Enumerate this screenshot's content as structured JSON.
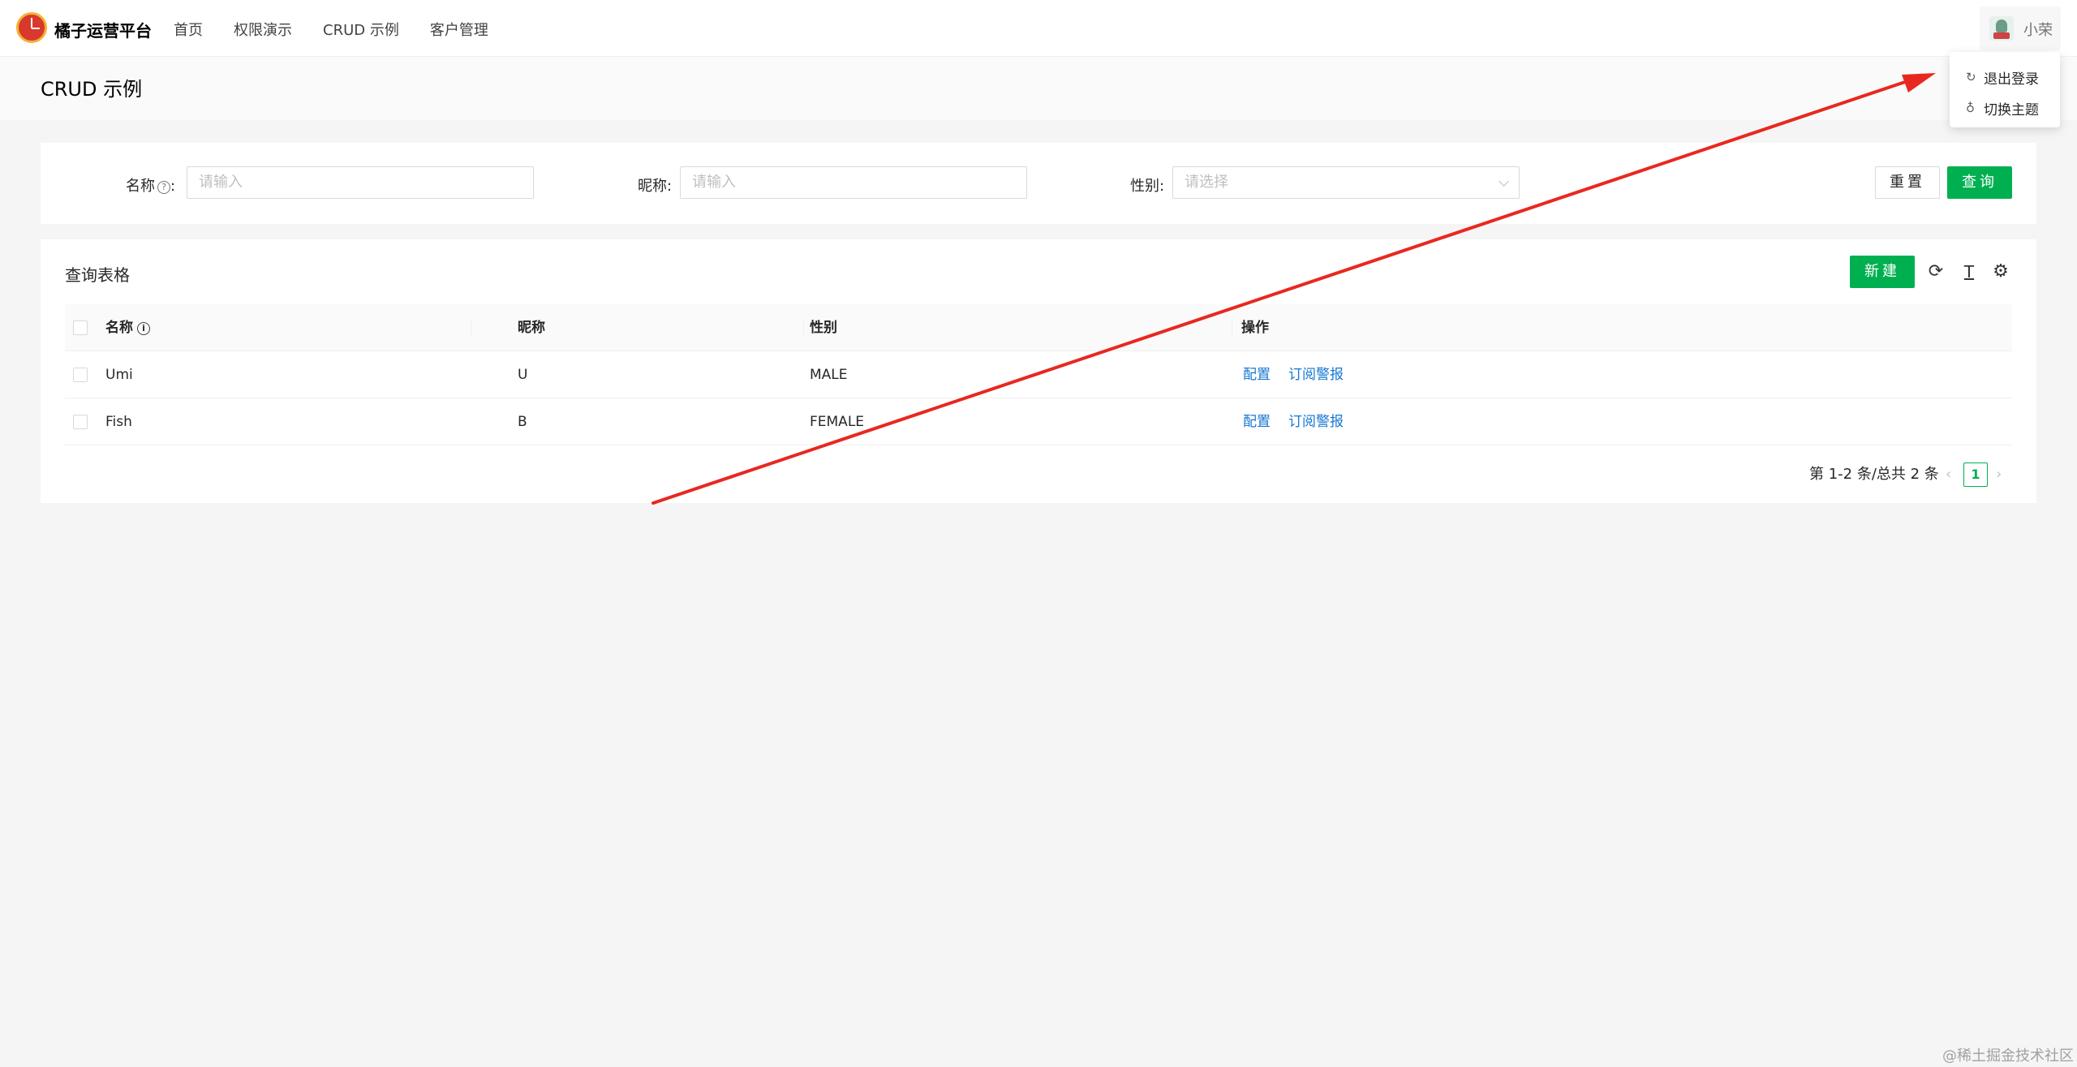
{
  "header": {
    "app_title": "橘子运营平台",
    "nav": [
      "首页",
      "权限演示",
      "CRUD 示例",
      "客户管理"
    ],
    "user_name": "小荣"
  },
  "user_menu": {
    "items": [
      {
        "icon": "logout-icon",
        "label": "退出登录"
      },
      {
        "icon": "bulb-icon",
        "label": "切换主题"
      }
    ]
  },
  "page": {
    "title": "CRUD 示例"
  },
  "search": {
    "name_label": "名称",
    "name_help_icon": "question-circle-icon",
    "name_placeholder": "请输入",
    "nickname_label": "昵称:",
    "nickname_placeholder": "请输入",
    "gender_label": "性别:",
    "gender_placeholder": "请选择",
    "reset_label": "重置",
    "query_label": "查询"
  },
  "table": {
    "title": "查询表格",
    "new_label": "新建",
    "columns": [
      "名称",
      "昵称",
      "性别",
      "操作"
    ],
    "rows": [
      {
        "name": "Umi",
        "nickname": "U",
        "gender": "MALE",
        "action_config": "配置",
        "action_subscribe": "订阅警报"
      },
      {
        "name": "Fish",
        "nickname": "B",
        "gender": "FEMALE",
        "action_config": "配置",
        "action_subscribe": "订阅警报"
      }
    ],
    "pagination": {
      "summary": "第 1-2 条/总共 2 条",
      "current_page": "1"
    }
  },
  "colors": {
    "primary": "#00b050",
    "link": "#1677d3",
    "annotation_arrow": "#e8281f"
  },
  "watermark": "@稀土掘金技术社区"
}
